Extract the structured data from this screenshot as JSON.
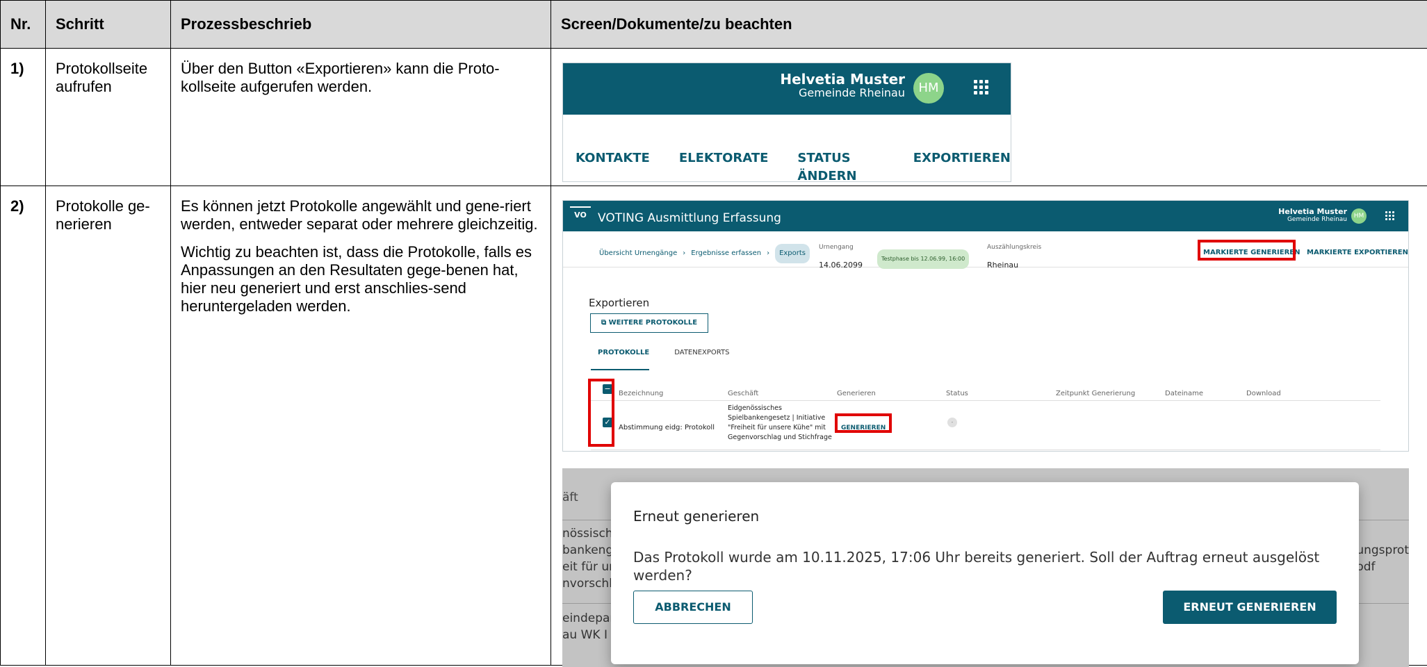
{
  "headers": {
    "nr": "Nr.",
    "schritt": "Schritt",
    "prozess": "Prozessbeschrieb",
    "screen": "Screen/Dokumente/zu beachten"
  },
  "rows": [
    {
      "nr": "1)",
      "schritt": "Protokollseite aufrufen",
      "prozess": [
        "Über den Button «Exportieren» kann die Proto-kollseite aufgerufen werden."
      ]
    },
    {
      "nr": "2)",
      "schritt": "Protokolle ge-nerieren",
      "prozess": [
        "Es können jetzt Protokolle angewählt und gene-riert werden, entweder separat oder mehrere gleichzeitig.",
        "Wichtig zu beachten ist, dass die Protokolle, falls es Anpassungen an den Resultaten gege-benen hat, hier neu generiert und erst anschlies-send heruntergeladen werden."
      ]
    }
  ],
  "shot1": {
    "user_name": "Helvetia Muster",
    "user_org": "Gemeinde Rheinau",
    "avatar": "HM",
    "nav": [
      "KONTAKTE",
      "ELEKTORATE",
      "STATUS ÄNDERN",
      "EXPORTIEREN"
    ]
  },
  "shot2": {
    "logo": "VO",
    "app_title": "VOTING Ausmittlung Erfassung",
    "user_name": "Helvetia Muster",
    "user_org": "Gemeinde Rheinau",
    "avatar": "HM",
    "crumb1": "Übersicht Urnengänge",
    "crumb2": "Ergebnisse erfassen",
    "crumb3": "Exports",
    "urnengang_label": "Urnengang",
    "urnengang_value": "14.06.2099",
    "testphase": "Testphase bis 12.06.99, 16:00",
    "kreis_label": "Auszählungskreis",
    "kreis_value": "Rheinau",
    "action_generate": "MARKIERTE GENERIEREN",
    "action_export": "MARKIERTE EXPORTIEREN",
    "heading": "Exportieren",
    "more_button": "WEITERE PROTOKOLLE",
    "tab_protokolle": "PROTOKOLLE",
    "tab_datenexports": "DATENEXPORTS",
    "col_bezeichnung": "Bezeichnung",
    "col_geschaeft": "Geschäft",
    "col_generieren": "Generieren",
    "col_status": "Status",
    "col_zeitpunkt": "Zeitpunkt Generierung",
    "col_dateiname": "Dateiname",
    "col_download": "Download",
    "row_bezeichnung": "Abstimmung eidg: Protokoll",
    "row_geschaeft": [
      "Eidgenössisches",
      "Spielbankengesetz | Initiative",
      "\"Freiheit für unsere Kühe\" mit",
      "Gegenvorschlag und Stichfrage"
    ],
    "row_generate": "GENERIEREN",
    "row_status": "-"
  },
  "shot3": {
    "bg_col": "äft",
    "bg_lines": [
      "nössisch",
      "bankenge",
      "eit für ur",
      "nvorschl",
      "eindeparl",
      "au WK I"
    ],
    "bg_right": [
      "ungsprot",
      "odf"
    ],
    "dialog_title": "Erneut generieren",
    "dialog_message": "Das Protokoll wurde am 10.11.2025, 17:06 Uhr bereits generiert. Soll der Auftrag erneut ausgelöst werden?",
    "cancel": "ABBRECHEN",
    "confirm": "ERNEUT GENERIEREN"
  }
}
